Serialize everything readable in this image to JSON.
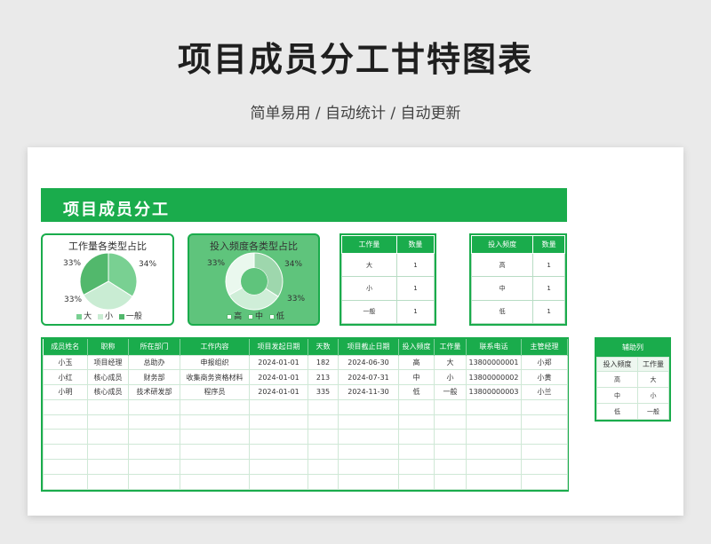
{
  "header": {
    "title": "项目成员分工甘特图表",
    "subtitle": "简单易用  /  自动统计  /  自动更新"
  },
  "banner": {
    "text": "项目成员分工"
  },
  "chart_data": [
    {
      "type": "pie",
      "title": "工作量各类型占比",
      "categories": [
        "大",
        "小",
        "一般"
      ],
      "values": [
        34,
        33,
        33
      ],
      "labels": [
        "34%",
        "33%",
        "33%"
      ],
      "colors": [
        "#79d092",
        "#c9ecd3",
        "#52b86c"
      ],
      "legend": "bottom"
    },
    {
      "type": "pie",
      "title": "投入频度各类型占比",
      "categories": [
        "高",
        "中",
        "低"
      ],
      "values": [
        34,
        33,
        33
      ],
      "labels": [
        "34%",
        "33%",
        "33%"
      ],
      "colors": [
        "#9ed7ad",
        "#cfeed8",
        "#eaf8ee"
      ],
      "donut": true,
      "legend": "bottom"
    }
  ],
  "workload_table": {
    "headers": [
      "工作量",
      "数量"
    ],
    "rows": [
      [
        "大",
        "1"
      ],
      [
        "小",
        "1"
      ],
      [
        "一般",
        "1"
      ]
    ]
  },
  "frequency_table": {
    "headers": [
      "投入频度",
      "数量"
    ],
    "rows": [
      [
        "高",
        "1"
      ],
      [
        "中",
        "1"
      ],
      [
        "低",
        "1"
      ]
    ]
  },
  "members_table": {
    "headers": [
      "成员姓名",
      "职称",
      "所在部门",
      "工作内容",
      "项目发起日期",
      "天数",
      "项目截止日期",
      "投入频度",
      "工作量",
      "联系电话",
      "主管经理"
    ],
    "rows": [
      [
        "小玉",
        "项目经理",
        "总助办",
        "申报组织",
        "2024-01-01",
        "182",
        "2024-06-30",
        "高",
        "大",
        "13800000001",
        "小郑"
      ],
      [
        "小红",
        "核心成员",
        "财务部",
        "收集商务资格材料",
        "2024-01-01",
        "213",
        "2024-07-31",
        "中",
        "小",
        "13800000002",
        "小黄"
      ],
      [
        "小明",
        "核心成员",
        "技术研发部",
        "程序员",
        "2024-01-01",
        "335",
        "2024-11-30",
        "低",
        "一般",
        "13800000003",
        "小兰"
      ]
    ],
    "empty_rows": 6
  },
  "aux_table": {
    "title": "辅助列",
    "headers": [
      "投入频度",
      "工作量"
    ],
    "rows": [
      [
        "高",
        "大"
      ],
      [
        "中",
        "小"
      ],
      [
        "低",
        "一般"
      ]
    ]
  }
}
